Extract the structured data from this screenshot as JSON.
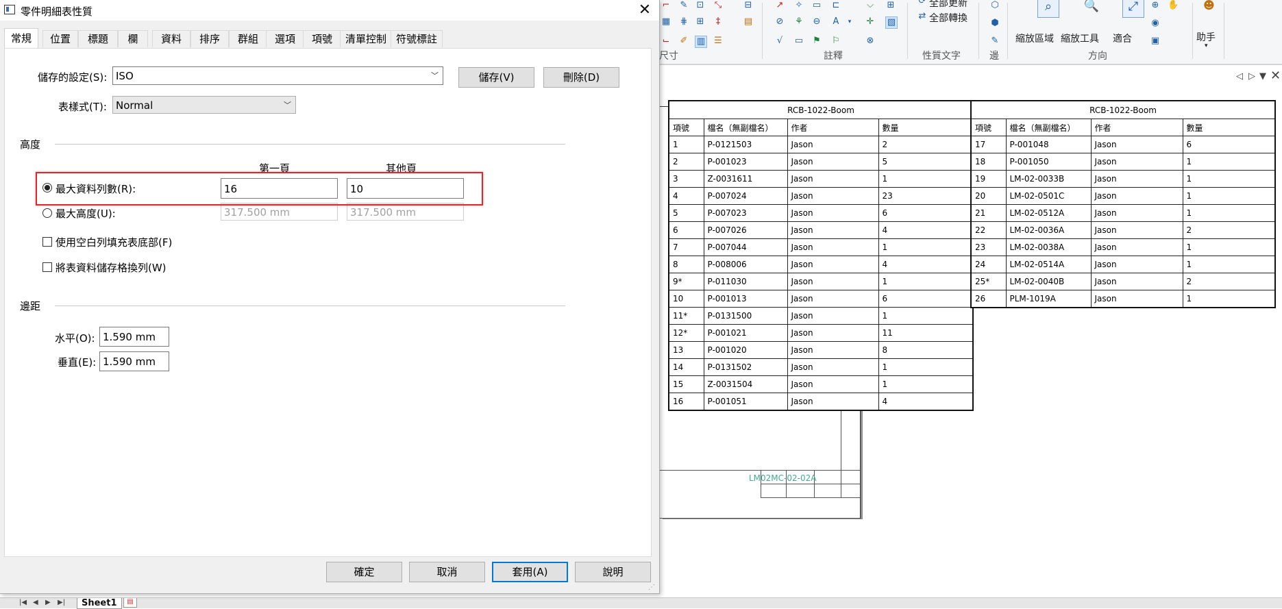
{
  "dialog": {
    "title": "零件明細表性質",
    "tabs": [
      "常規",
      "位置",
      "標題",
      "欄",
      "資料",
      "排序",
      "群組",
      "選項",
      "項號",
      "清單控制",
      "符號標註"
    ],
    "active_tab": "常規",
    "saved_settings_label": "儲存的設定(S):",
    "saved_settings_value": "ISO",
    "save_button": "儲存(V)",
    "delete_button": "刪除(D)",
    "table_style_label": "表樣式(T):",
    "table_style_value": "Normal",
    "height_group": "高度",
    "first_page_header": "第一頁",
    "other_pages_header": "其他頁",
    "max_rows_label": "最大資料列數(R):",
    "max_rows_first": "16",
    "max_rows_other": "10",
    "max_height_label": "最大高度(U):",
    "max_height_first": "317.500 mm",
    "max_height_other": "317.500 mm",
    "fill_blank_label": "使用空白列填充表底部(F)",
    "wrap_rows_label": "將表資料儲存格換列(W)",
    "margins_group": "邊距",
    "horizontal_label": "水平(O):",
    "horizontal_value": "1.590 mm",
    "vertical_label": "垂直(E):",
    "vertical_value": "1.590 mm",
    "ok_button": "確定",
    "cancel_button": "取消",
    "apply_button": "套用(A)",
    "help_button": "說明"
  },
  "ribbon": {
    "update_all": "全部更新",
    "convert_all": "全部轉換",
    "dimension_group": "尺寸",
    "annotation_group": "註釋",
    "property_text_group": "性質文字",
    "edge_group": "邊",
    "zoom_area": "縮放區域",
    "zoom_tool": "縮放工具",
    "fit": "適合",
    "orientation_group": "方向",
    "assistant": "助手"
  },
  "bom": {
    "title": "RCB-1022-Boom",
    "headers": [
      "項號",
      "檔名（無副檔名）",
      "作者",
      "數量"
    ],
    "table1_rows": [
      [
        "1",
        "P-0121503",
        "Jason",
        "2"
      ],
      [
        "2",
        "P-001023",
        "Jason",
        "5"
      ],
      [
        "3",
        "Z-0031611",
        "Jason",
        "1"
      ],
      [
        "4",
        "P-007024",
        "Jason",
        "23"
      ],
      [
        "5",
        "P-007023",
        "Jason",
        "6"
      ],
      [
        "6",
        "P-007026",
        "Jason",
        "4"
      ],
      [
        "7",
        "P-007044",
        "Jason",
        "1"
      ],
      [
        "8",
        "P-008006",
        "Jason",
        "4"
      ],
      [
        "9*",
        "P-011030",
        "Jason",
        "1"
      ],
      [
        "10",
        "P-001013",
        "Jason",
        "6"
      ],
      [
        "11*",
        "P-0131500",
        "Jason",
        "1"
      ],
      [
        "12*",
        "P-001021",
        "Jason",
        "11"
      ],
      [
        "13",
        "P-001020",
        "Jason",
        "8"
      ],
      [
        "14",
        "P-0131502",
        "Jason",
        "1"
      ],
      [
        "15",
        "Z-0031504",
        "Jason",
        "1"
      ],
      [
        "16",
        "P-001051",
        "Jason",
        "4"
      ]
    ],
    "table2_rows": [
      [
        "17",
        "P-001048",
        "Jason",
        "6"
      ],
      [
        "18",
        "P-001050",
        "Jason",
        "1"
      ],
      [
        "19",
        "LM-02-0033B",
        "Jason",
        "1"
      ],
      [
        "20",
        "LM-02-0501C",
        "Jason",
        "1"
      ],
      [
        "21",
        "LM-02-0512A",
        "Jason",
        "1"
      ],
      [
        "22",
        "LM-02-0036A",
        "Jason",
        "2"
      ],
      [
        "23",
        "LM-02-0038A",
        "Jason",
        "1"
      ],
      [
        "24",
        "LM-02-0514A",
        "Jason",
        "1"
      ],
      [
        "25*",
        "LM-02-0040B",
        "Jason",
        "2"
      ],
      [
        "26",
        "PLM-1019A",
        "Jason",
        "1"
      ]
    ]
  },
  "sheet": {
    "title_block_text": "LM02MC-02-02A",
    "tab_name": "Sheet1"
  }
}
